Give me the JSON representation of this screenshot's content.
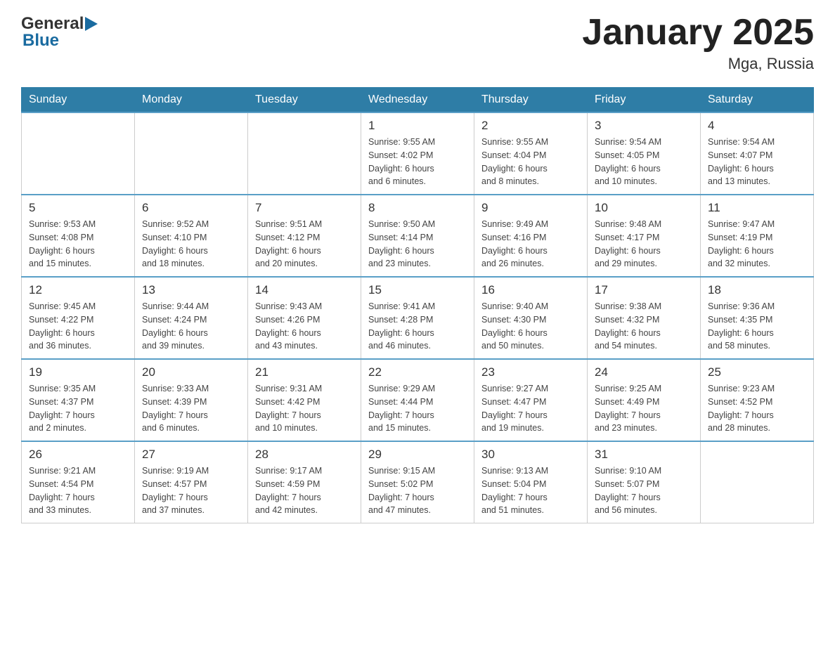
{
  "header": {
    "logo_general": "General",
    "logo_blue": "Blue",
    "title": "January 2025",
    "location": "Mga, Russia"
  },
  "days_header": [
    "Sunday",
    "Monday",
    "Tuesday",
    "Wednesday",
    "Thursday",
    "Friday",
    "Saturday"
  ],
  "weeks": [
    [
      {
        "day": "",
        "info": ""
      },
      {
        "day": "",
        "info": ""
      },
      {
        "day": "",
        "info": ""
      },
      {
        "day": "1",
        "info": "Sunrise: 9:55 AM\nSunset: 4:02 PM\nDaylight: 6 hours\nand 6 minutes."
      },
      {
        "day": "2",
        "info": "Sunrise: 9:55 AM\nSunset: 4:04 PM\nDaylight: 6 hours\nand 8 minutes."
      },
      {
        "day": "3",
        "info": "Sunrise: 9:54 AM\nSunset: 4:05 PM\nDaylight: 6 hours\nand 10 minutes."
      },
      {
        "day": "4",
        "info": "Sunrise: 9:54 AM\nSunset: 4:07 PM\nDaylight: 6 hours\nand 13 minutes."
      }
    ],
    [
      {
        "day": "5",
        "info": "Sunrise: 9:53 AM\nSunset: 4:08 PM\nDaylight: 6 hours\nand 15 minutes."
      },
      {
        "day": "6",
        "info": "Sunrise: 9:52 AM\nSunset: 4:10 PM\nDaylight: 6 hours\nand 18 minutes."
      },
      {
        "day": "7",
        "info": "Sunrise: 9:51 AM\nSunset: 4:12 PM\nDaylight: 6 hours\nand 20 minutes."
      },
      {
        "day": "8",
        "info": "Sunrise: 9:50 AM\nSunset: 4:14 PM\nDaylight: 6 hours\nand 23 minutes."
      },
      {
        "day": "9",
        "info": "Sunrise: 9:49 AM\nSunset: 4:16 PM\nDaylight: 6 hours\nand 26 minutes."
      },
      {
        "day": "10",
        "info": "Sunrise: 9:48 AM\nSunset: 4:17 PM\nDaylight: 6 hours\nand 29 minutes."
      },
      {
        "day": "11",
        "info": "Sunrise: 9:47 AM\nSunset: 4:19 PM\nDaylight: 6 hours\nand 32 minutes."
      }
    ],
    [
      {
        "day": "12",
        "info": "Sunrise: 9:45 AM\nSunset: 4:22 PM\nDaylight: 6 hours\nand 36 minutes."
      },
      {
        "day": "13",
        "info": "Sunrise: 9:44 AM\nSunset: 4:24 PM\nDaylight: 6 hours\nand 39 minutes."
      },
      {
        "day": "14",
        "info": "Sunrise: 9:43 AM\nSunset: 4:26 PM\nDaylight: 6 hours\nand 43 minutes."
      },
      {
        "day": "15",
        "info": "Sunrise: 9:41 AM\nSunset: 4:28 PM\nDaylight: 6 hours\nand 46 minutes."
      },
      {
        "day": "16",
        "info": "Sunrise: 9:40 AM\nSunset: 4:30 PM\nDaylight: 6 hours\nand 50 minutes."
      },
      {
        "day": "17",
        "info": "Sunrise: 9:38 AM\nSunset: 4:32 PM\nDaylight: 6 hours\nand 54 minutes."
      },
      {
        "day": "18",
        "info": "Sunrise: 9:36 AM\nSunset: 4:35 PM\nDaylight: 6 hours\nand 58 minutes."
      }
    ],
    [
      {
        "day": "19",
        "info": "Sunrise: 9:35 AM\nSunset: 4:37 PM\nDaylight: 7 hours\nand 2 minutes."
      },
      {
        "day": "20",
        "info": "Sunrise: 9:33 AM\nSunset: 4:39 PM\nDaylight: 7 hours\nand 6 minutes."
      },
      {
        "day": "21",
        "info": "Sunrise: 9:31 AM\nSunset: 4:42 PM\nDaylight: 7 hours\nand 10 minutes."
      },
      {
        "day": "22",
        "info": "Sunrise: 9:29 AM\nSunset: 4:44 PM\nDaylight: 7 hours\nand 15 minutes."
      },
      {
        "day": "23",
        "info": "Sunrise: 9:27 AM\nSunset: 4:47 PM\nDaylight: 7 hours\nand 19 minutes."
      },
      {
        "day": "24",
        "info": "Sunrise: 9:25 AM\nSunset: 4:49 PM\nDaylight: 7 hours\nand 23 minutes."
      },
      {
        "day": "25",
        "info": "Sunrise: 9:23 AM\nSunset: 4:52 PM\nDaylight: 7 hours\nand 28 minutes."
      }
    ],
    [
      {
        "day": "26",
        "info": "Sunrise: 9:21 AM\nSunset: 4:54 PM\nDaylight: 7 hours\nand 33 minutes."
      },
      {
        "day": "27",
        "info": "Sunrise: 9:19 AM\nSunset: 4:57 PM\nDaylight: 7 hours\nand 37 minutes."
      },
      {
        "day": "28",
        "info": "Sunrise: 9:17 AM\nSunset: 4:59 PM\nDaylight: 7 hours\nand 42 minutes."
      },
      {
        "day": "29",
        "info": "Sunrise: 9:15 AM\nSunset: 5:02 PM\nDaylight: 7 hours\nand 47 minutes."
      },
      {
        "day": "30",
        "info": "Sunrise: 9:13 AM\nSunset: 5:04 PM\nDaylight: 7 hours\nand 51 minutes."
      },
      {
        "day": "31",
        "info": "Sunrise: 9:10 AM\nSunset: 5:07 PM\nDaylight: 7 hours\nand 56 minutes."
      },
      {
        "day": "",
        "info": ""
      }
    ]
  ]
}
